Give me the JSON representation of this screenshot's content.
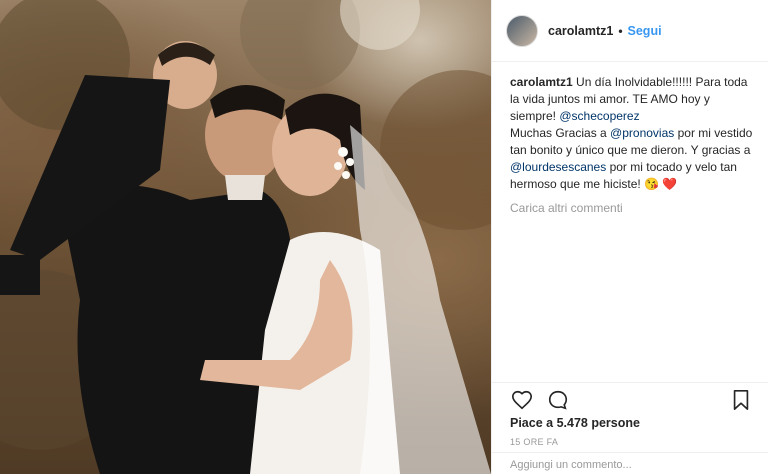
{
  "post": {
    "username": "carolamtz1",
    "separator": "•",
    "follow_label": "Segui",
    "caption": {
      "author": "carolamtz1",
      "line1": " Un día Inolvidable!!!!!! Para toda la vida juntos mi amor. TE AMO hoy y siempre! ",
      "mention1": "@schecoperez",
      "line2": "Muchas Gracias a ",
      "mention2": "@pronovias",
      "line3": " por mi vestido tan bonito y único que me dieron. Y gracias a ",
      "mention3": "@lourdesescanes",
      "line4": " por mi tocado y velo tan hermoso que me hiciste! 😘 ❤️"
    },
    "load_more_label": "Carica altri commenti",
    "likes_text": "Piace a 5.478 persone",
    "time_text": "15 ORE FA",
    "comment_placeholder": "Aggiungi un commento..."
  },
  "icons": {
    "like": "heart-icon",
    "comment": "comment-icon",
    "save": "bookmark-icon"
  },
  "colors": {
    "accent": "#3897f0",
    "mention": "#003569",
    "muted": "#999999"
  }
}
